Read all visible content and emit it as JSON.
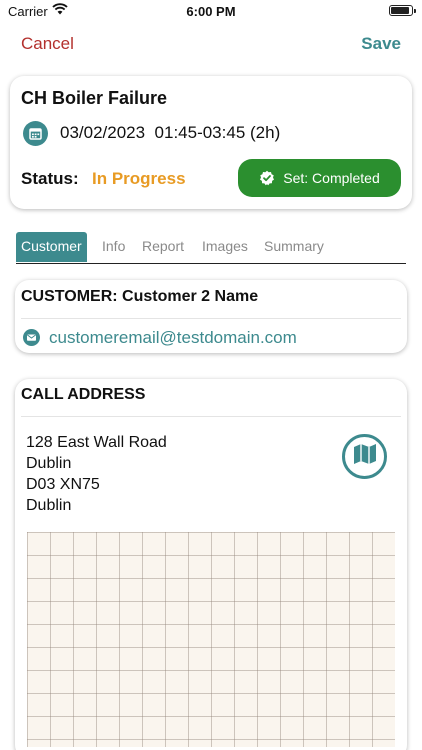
{
  "status_bar": {
    "carrier": "Carrier",
    "time": "6:00 PM"
  },
  "nav": {
    "cancel_label": "Cancel",
    "save_label": "Save"
  },
  "job": {
    "title": "CH Boiler Failure",
    "date_time": "03/02/2023  01:45-03:45 (2h)",
    "status_label": "Status:",
    "status_value": "In Progress",
    "complete_button_label": "Set: Completed"
  },
  "tabs": [
    {
      "label": "Customer",
      "active": true
    },
    {
      "label": "Info",
      "active": false
    },
    {
      "label": "Report",
      "active": false
    },
    {
      "label": "Images",
      "active": false
    },
    {
      "label": "Summary",
      "active": false
    }
  ],
  "customer": {
    "title": "CUSTOMER: Customer 2 Name",
    "email": "customeremail@testdomain.com"
  },
  "address": {
    "title": "CALL ADDRESS",
    "lines": [
      "128 East Wall Road",
      "Dublin",
      "D03 XN75",
      "Dublin"
    ]
  },
  "colors": {
    "accent": "#3d8a8e",
    "cancel": "#b3302d",
    "status_in_progress": "#e89b24",
    "complete_button": "#2b8f2f"
  },
  "icons": {
    "wifi": "wifi-icon",
    "battery": "battery-icon",
    "calendar": "calendar-icon",
    "check": "check-badge-icon",
    "email": "envelope-icon",
    "map": "map-icon"
  }
}
